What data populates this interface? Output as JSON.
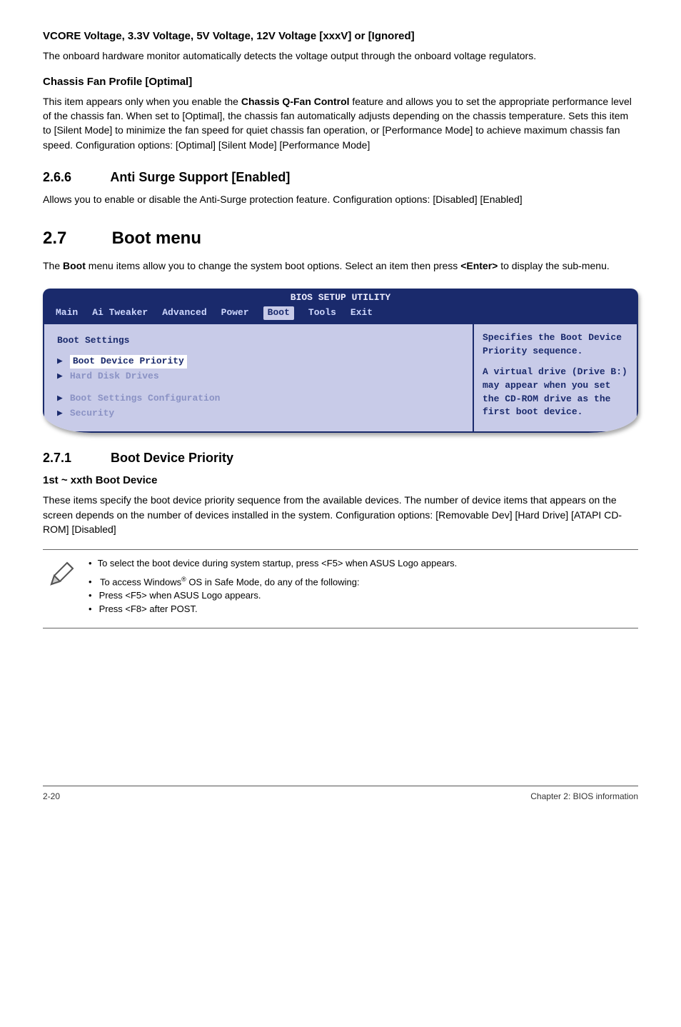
{
  "section_vcore": {
    "heading": "VCORE Voltage, 3.3V Voltage, 5V Voltage, 12V Voltage [xxxV] or [Ignored]",
    "body": "The onboard hardware monitor automatically detects the voltage output through the onboard voltage regulators."
  },
  "section_fan": {
    "heading": "Chassis Fan Profile [Optimal]",
    "body": "This item appears only when you enable the Chassis Q-Fan Control feature and allows you to set the appropriate performance level of the chassis fan. When set to [Optimal], the chassis fan automatically adjusts depending on the chassis temperature. Sets this item to [Silent Mode] to minimize the fan speed for quiet chassis fan operation, or [Performance Mode] to achieve maximum chassis fan speed. Configuration options: [Optimal] [Silent Mode] [Performance Mode]"
  },
  "section_266": {
    "num": "2.6.6",
    "title": "Anti Surge Support [Enabled]",
    "body": "Allows you to enable or disable the Anti-Surge protection feature. Configuration options: [Disabled] [Enabled]"
  },
  "section_27": {
    "num": "2.7",
    "title": "Boot menu",
    "body": "The Boot menu items allow you to change the system boot options. Select an item then press <Enter> to display the sub-menu."
  },
  "bios": {
    "title": "BIOS SETUP UTILITY",
    "tabs": [
      "Main",
      "Ai Tweaker",
      "Advanced",
      "Power",
      "Boot",
      "Tools",
      "Exit"
    ],
    "active_tab_index": 4,
    "group_title": "Boot Settings",
    "items": [
      {
        "text": "Boot Device Priority",
        "style": "highlight"
      },
      {
        "text": "Hard Disk Drives",
        "style": "muted"
      },
      {
        "text": "Boot Settings Configuration",
        "style": "muted",
        "spacer_before": true
      },
      {
        "text": "Security",
        "style": "muted"
      }
    ],
    "help1": "Specifies the Boot Device Priority sequence.",
    "help2": "A virtual drive (Drive B:) may appear when you set the CD-ROM drive as the first boot device."
  },
  "section_271": {
    "num": "2.7.1",
    "title": "Boot Device Priority"
  },
  "section_bootdev": {
    "heading": "1st ~ xxth Boot Device",
    "body": "These items specify the boot device priority sequence from the available devices. The number of device items that appears on the screen depends on the number of devices installed in the system. Configuration options: [Removable Dev] [Hard Drive] [ATAPI CD-ROM] [Disabled]"
  },
  "note": {
    "bullet1": "To select the boot device during system startup, press <F5> when ASUS Logo appears.",
    "bullet2_pre": "To access Windows",
    "bullet2_post": " OS in Safe Mode, do any of the following:",
    "sub1": "Press <F5> when ASUS Logo appears.",
    "sub2": "Press <F8> after POST."
  },
  "footer": {
    "left": "2-20",
    "right": "Chapter 2: BIOS information"
  }
}
